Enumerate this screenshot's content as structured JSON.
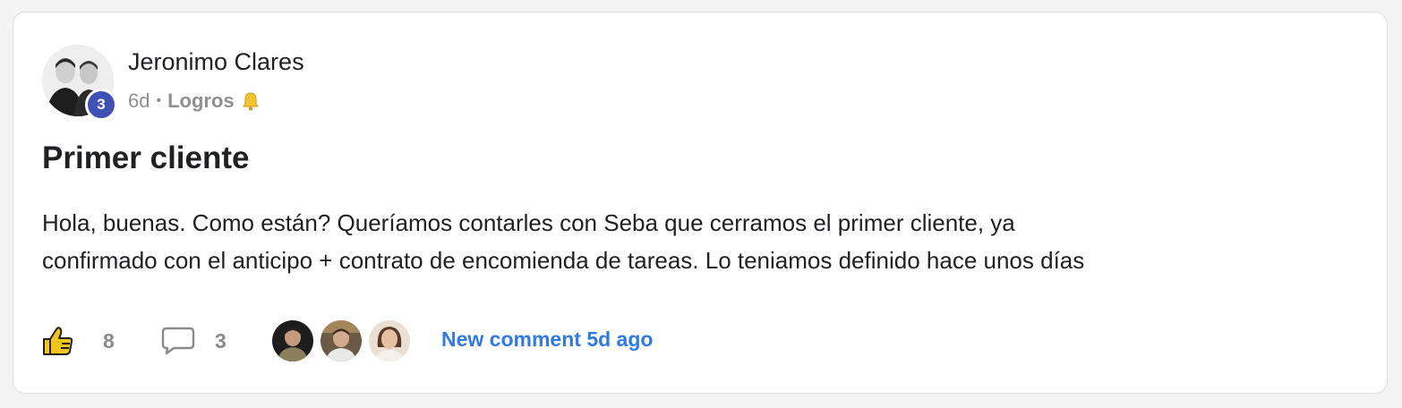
{
  "post": {
    "author_name": "Jeronimo Clares",
    "author_level": "3",
    "time_ago": "6d",
    "separator": "•",
    "category": "Logros",
    "title": "Primer cliente",
    "body_lines": [
      "Hola, buenas. Como están? Queríamos contarles con Seba que cerramos el primer cliente, ya",
      "confirmado con el anticipo + contrato de encomienda de tareas. Lo teniamos definido hace unos días"
    ],
    "likes_count": "8",
    "comments_count": "3",
    "new_comment_text": "New comment 5d ago",
    "icons": {
      "like": "thumbs-up-icon",
      "comment": "comment-bubble-icon",
      "category": "bell-icon"
    },
    "colors": {
      "accent_link": "#2f7ae5",
      "level_badge": "#3f51b5",
      "muted_text": "#909090"
    }
  }
}
